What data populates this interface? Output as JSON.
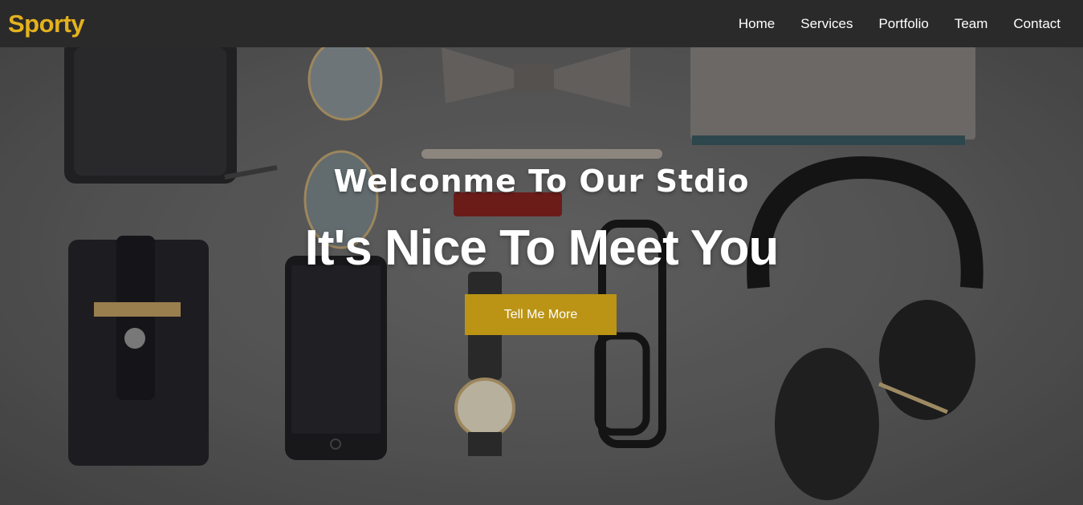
{
  "brand": {
    "name": "Sporty",
    "color": "#e4b21e"
  },
  "nav": {
    "items": [
      "Home",
      "Services",
      "Portfolio",
      "Team",
      "Contact"
    ]
  },
  "hero": {
    "subtitle": "Welconme To Our Stdio",
    "title": "It's Nice To Meet You",
    "cta_label": "Tell Me More",
    "cta_color": "#bb9416"
  }
}
